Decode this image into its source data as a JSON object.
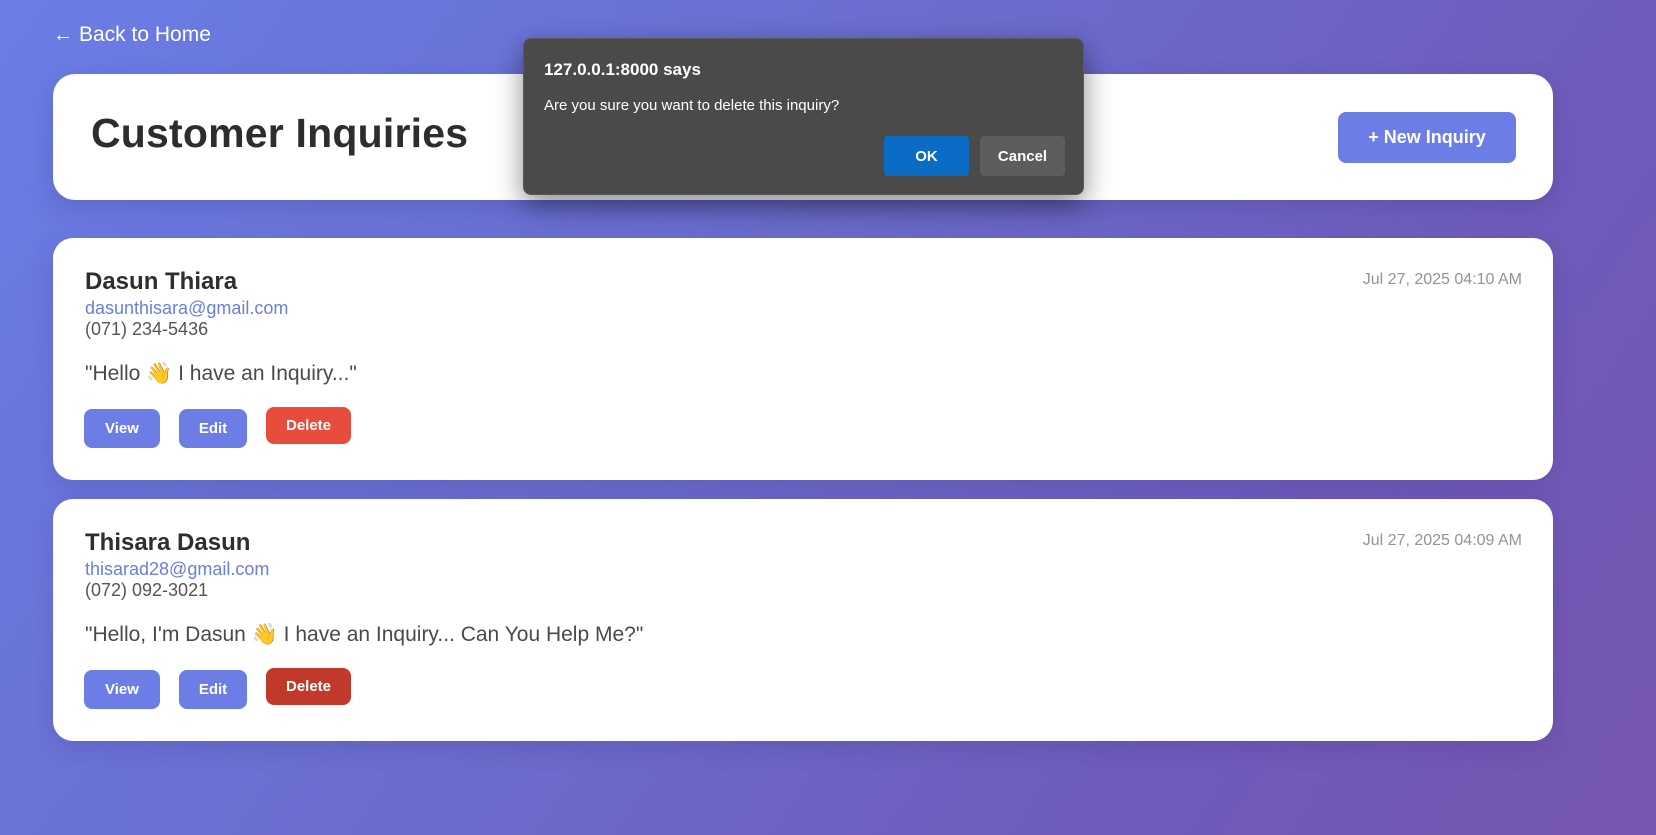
{
  "nav": {
    "back_label": "Back to Home",
    "back_icon": "arrow-left-icon"
  },
  "header": {
    "title": "Customer Inquiries",
    "new_button_label": "+ New Inquiry"
  },
  "inquiries": [
    {
      "name": "Dasun Thiara",
      "email": "dasunthisara@gmail.com",
      "phone": "(071) 234-5436",
      "date": "Jul 27, 2025 04:10 AM",
      "message": "\"Hello 👋 I have an Inquiry...\"",
      "view_label": "View",
      "edit_label": "Edit",
      "delete_label": "Delete"
    },
    {
      "name": "Thisara Dasun",
      "email": "thisarad28@gmail.com",
      "phone": "(072) 092-3021",
      "date": "Jul 27, 2025 04:09 AM",
      "message": "\"Hello, I'm Dasun 👋 I have an Inquiry... Can You Help Me?\"",
      "view_label": "View",
      "edit_label": "Edit",
      "delete_label": "Delete"
    }
  ],
  "dialog": {
    "title": "127.0.0.1:8000 says",
    "message": "Are you sure you want to delete this inquiry?",
    "ok_label": "OK",
    "cancel_label": "Cancel"
  },
  "colors": {
    "accent": "#6c7ee6",
    "delete": "#e84c3d",
    "delete_active": "#c0392b",
    "dialog_bg": "#4a4a4a",
    "dialog_ok": "#0a6cc4"
  }
}
